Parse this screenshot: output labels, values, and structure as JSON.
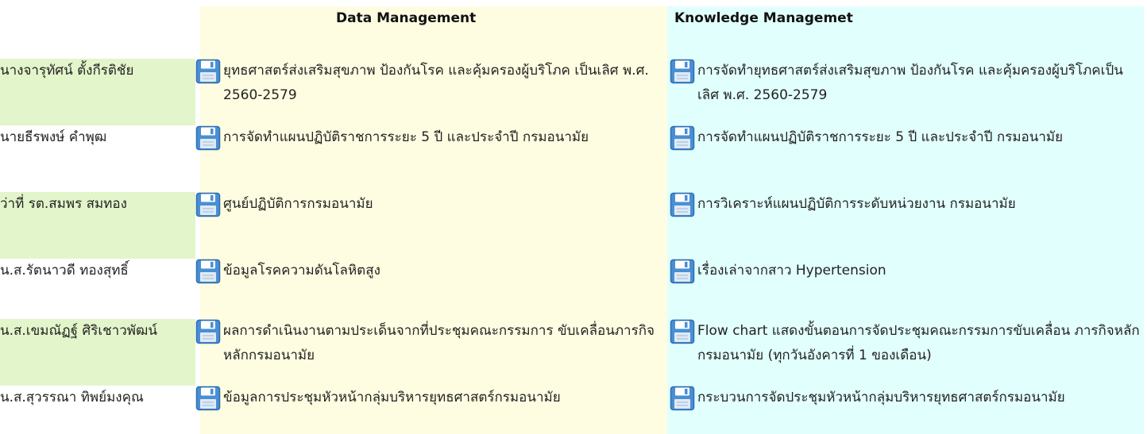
{
  "headers": {
    "data_management": "Data Management",
    "knowledge_management": "Knowledge Managemet"
  },
  "colors": {
    "name_highlight": "#e3f5ca",
    "data_column_bg": "#fffde1",
    "knowledge_column_bg": "#e1fffd",
    "disk_icon_blue": "#4a8fd4"
  },
  "icons": {
    "file": "floppy-disk-icon"
  },
  "rows": [
    {
      "name": "นางจารุทัศน์ ตั้งกีรติชัย",
      "highlight": true,
      "data": "ยุทธศาสตร์ส่งเสริมสุขภาพ ป้องกันโรค และคุ้มครองผู้บริโภค เป็นเลิศ พ.ศ. 2560-2579",
      "knowledge": "การจัดทำยุทธศาสตร์ส่งเสริมสุขภาพ ป้องกันโรค และคุ้มครองผู้บริโภคเป็นเลิศ พ.ศ. 2560-2579"
    },
    {
      "name": "นายธีรพงษ์ คำพุฒ",
      "highlight": false,
      "data": "การจัดทำแผนปฏิบัติราชการระยะ 5 ปี และประจำปี กรมอนามัย",
      "knowledge": "การจัดทำแผนปฏิบัติราชการระยะ 5 ปี และประจำปี กรมอนามัย"
    },
    {
      "name": "ว่าที่ รต.สมพร สมทอง",
      "highlight": true,
      "data": "ศูนย์ปฏิบัติการกรมอนามัย",
      "knowledge": "การวิเคราะห์แผนปฏิบัติการระดับหน่วยงาน กรมอนามัย"
    },
    {
      "name": "น.ส.รัตนาวดี ทองสุทธิ์",
      "highlight": false,
      "data": "ข้อมูลโรคความดันโลหิตสูง",
      "knowledge": "เรื่องเล่าจากสาว Hypertension"
    },
    {
      "name": "น.ส.เขมณัฏฐ์ ศิริเชาวพัฒน์",
      "highlight": true,
      "data": "ผลการดำเนินงานตามประเด็นจากที่ประชุมคณะกรรมการ ขับเคลื่อนภารกิจหลักกรมอนามัย",
      "knowledge": "Flow chart แสดงขั้นตอนการจัดประชุมคณะกรรมการขับเคลื่อน ภารกิจหลัก กรมอนามัย (ทุกวันอังคารที่ 1 ของเดือน)"
    },
    {
      "name": "น.ส.สุวรรณา ทิพย์มงคุณ",
      "highlight": false,
      "data": "ข้อมูลการประชุมหัวหน้ากลุ่มบริหารยุทธศาสตร์กรมอนามัย",
      "knowledge": "กระบวนการจัดประชุมหัวหน้ากลุ่มบริหารยุทธศาสตร์กรมอนามัย"
    }
  ]
}
